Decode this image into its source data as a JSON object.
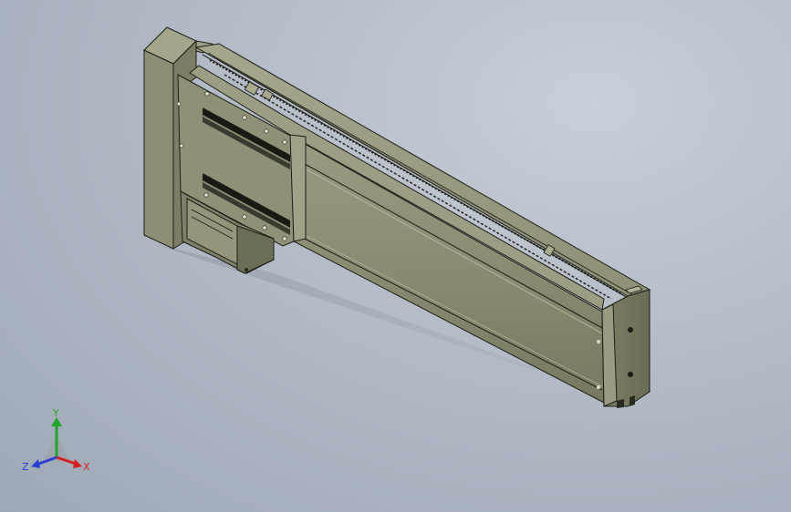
{
  "viewport": {
    "background_top": "#c9cfd8",
    "background_bottom": "#9fa9b6"
  },
  "model": {
    "body_color": "#8b8c72",
    "body_dark": "#5f604c",
    "body_light": "#a9aa8f",
    "edge_color": "#1d1d18"
  },
  "triad": {
    "x_label": "X",
    "y_label": "Y",
    "z_label": "Z",
    "x_color": "#d42020",
    "y_color": "#22a52a",
    "z_color": "#2a3fd0"
  }
}
